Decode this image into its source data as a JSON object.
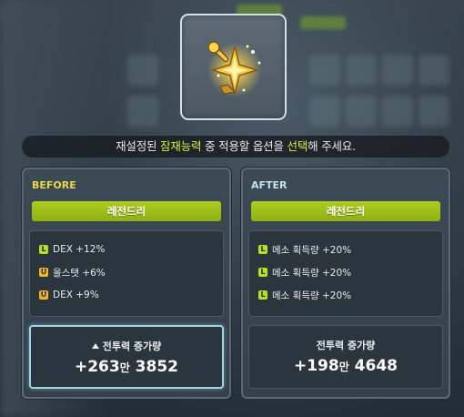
{
  "instruction": {
    "pre": "재설정된 ",
    "highlight1": "잠재능력",
    "mid": " 중 적용할 옵션을 ",
    "highlight2": "선택",
    "post": "해 주세요."
  },
  "item_icon": "legendary-ring-icon",
  "colors": {
    "grade_green": "#9cc01a",
    "highlight_yellow": "#d8ef3a",
    "badge_legendary": "#b8e022",
    "badge_unique": "#f0b820",
    "before_title": "#e8d84a",
    "after_title": "#c4e3ef"
  },
  "before": {
    "title": "BEFORE",
    "grade": "레전드리",
    "options": [
      {
        "badge": "L",
        "text": "DEX +12%"
      },
      {
        "badge": "U",
        "text": "올스탯 +6%"
      },
      {
        "badge": "U",
        "text": "DEX +9%"
      }
    ],
    "power_label": "전투력 증가량",
    "power_value_a": "+263",
    "power_unit": "만",
    "power_value_b": " 3852"
  },
  "after": {
    "title": "AFTER",
    "grade": "레전드리",
    "options": [
      {
        "badge": "L",
        "text": "메소 획득량 +20%"
      },
      {
        "badge": "L",
        "text": "메소 획득량 +20%"
      },
      {
        "badge": "L",
        "text": "메소 획득량 +20%"
      }
    ],
    "power_label": "전투력 증가량",
    "power_value_a": "+198",
    "power_unit": "만",
    "power_value_b": " 4648"
  }
}
